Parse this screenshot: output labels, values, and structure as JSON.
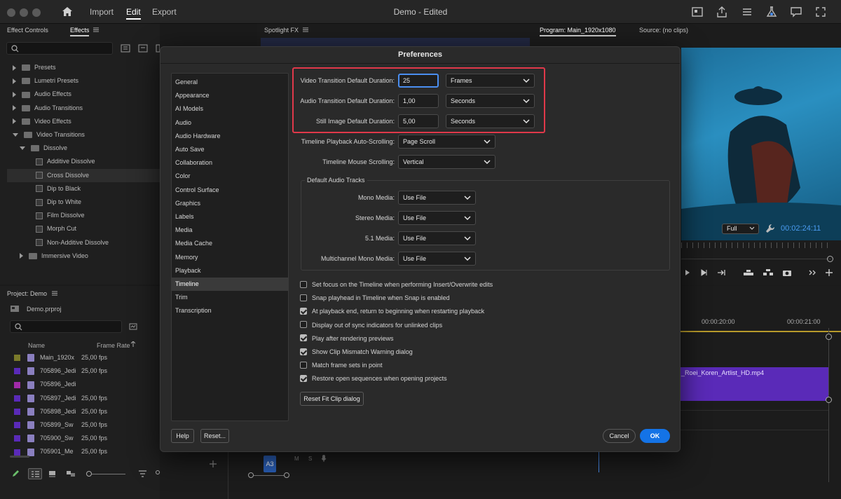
{
  "app": {
    "menu": {
      "import": "Import",
      "edit": "Edit",
      "export": "Export"
    },
    "document_title": "Demo - Edited"
  },
  "effects_panel": {
    "tab_effect_controls": "Effect Controls",
    "tab_effects": "Effects",
    "tree": [
      {
        "label": "Presets",
        "kind": "folder",
        "depth": 0,
        "expanded": false
      },
      {
        "label": "Lumetri Presets",
        "kind": "folder",
        "depth": 0,
        "expanded": false
      },
      {
        "label": "Audio Effects",
        "kind": "folder",
        "depth": 0,
        "expanded": false
      },
      {
        "label": "Audio Transitions",
        "kind": "folder",
        "depth": 0,
        "expanded": false
      },
      {
        "label": "Video Effects",
        "kind": "folder",
        "depth": 0,
        "expanded": false
      },
      {
        "label": "Video Transitions",
        "kind": "folder",
        "depth": 0,
        "expanded": true
      },
      {
        "label": "Dissolve",
        "kind": "folder",
        "depth": 1,
        "expanded": true
      },
      {
        "label": "Additive Dissolve",
        "kind": "effect",
        "depth": 2
      },
      {
        "label": "Cross Dissolve",
        "kind": "effect",
        "depth": 2,
        "selected": true
      },
      {
        "label": "Dip to Black",
        "kind": "effect",
        "depth": 2
      },
      {
        "label": "Dip to White",
        "kind": "effect",
        "depth": 2
      },
      {
        "label": "Film Dissolve",
        "kind": "effect",
        "depth": 2
      },
      {
        "label": "Morph Cut",
        "kind": "effect",
        "depth": 2
      },
      {
        "label": "Non-Additive Dissolve",
        "kind": "effect",
        "depth": 2
      },
      {
        "label": "Immersive Video",
        "kind": "folder",
        "depth": 1,
        "expanded": false
      }
    ]
  },
  "spotlight_panel": {
    "tab": "Spotlight FX"
  },
  "program_panel": {
    "tab_program": "Program: Main_1920x1080",
    "tab_source": "Source: (no clips)",
    "zoom": "Full",
    "timecode": "00:02:24:11"
  },
  "project_panel": {
    "title": "Project: Demo",
    "file": "Demo.prproj",
    "columns": {
      "name": "Name",
      "frame_rate": "Frame Rate"
    },
    "rows": [
      {
        "name": "Main_1920x",
        "fps": "25,00 fps",
        "color": "#7a7a2a"
      },
      {
        "name": "705896_Jedi",
        "fps": "25,00 fps",
        "color": "#5a2ab8"
      },
      {
        "name": "705896_Jedi",
        "fps": "",
        "color": "#a02aa8"
      },
      {
        "name": "705897_Jedi",
        "fps": "25,00 fps",
        "color": "#5a2ab8"
      },
      {
        "name": "705898_Jedi",
        "fps": "25,00 fps",
        "color": "#5a2ab8"
      },
      {
        "name": "705899_Sw",
        "fps": "25,00 fps",
        "color": "#5a2ab8"
      },
      {
        "name": "705900_Sw",
        "fps": "25,00 fps",
        "color": "#5a2ab8"
      },
      {
        "name": "705901_Me",
        "fps": "25,00 fps",
        "color": "#5a2ab8"
      }
    ]
  },
  "timeline": {
    "ruler": [
      "00:00:20:00",
      "00:00:21:00"
    ],
    "clip_name": "_Roei_Koren_Artlist_HD.mp4",
    "track_label": "A3",
    "track_m": "M",
    "track_s": "S"
  },
  "preferences": {
    "title": "Preferences",
    "categories": [
      "General",
      "Appearance",
      "AI Models",
      "Audio",
      "Audio Hardware",
      "Auto Save",
      "Collaboration",
      "Color",
      "Control Surface",
      "Graphics",
      "Labels",
      "Media",
      "Media Cache",
      "Memory",
      "Playback",
      "Timeline",
      "Trim",
      "Transcription"
    ],
    "selected_category": "Timeline",
    "video_transition": {
      "label": "Video Transition Default Duration:",
      "value": "25",
      "unit": "Frames"
    },
    "audio_transition": {
      "label": "Audio Transition Default Duration:",
      "value": "1,00",
      "unit": "Seconds"
    },
    "still_image": {
      "label": "Still Image Default Duration:",
      "value": "5,00",
      "unit": "Seconds"
    },
    "playback_scrolling": {
      "label": "Timeline Playback Auto-Scrolling:",
      "value": "Page Scroll"
    },
    "mouse_scrolling": {
      "label": "Timeline Mouse Scrolling:",
      "value": "Vertical"
    },
    "audio_tracks": {
      "group_title": "Default Audio Tracks",
      "mono": {
        "label": "Mono Media:",
        "value": "Use File"
      },
      "stereo": {
        "label": "Stereo Media:",
        "value": "Use File"
      },
      "surround": {
        "label": "5.1 Media:",
        "value": "Use File"
      },
      "multichannel": {
        "label": "Multichannel Mono Media:",
        "value": "Use File"
      }
    },
    "checkboxes": [
      {
        "label": "Set focus on the Timeline when performing Insert/Overwrite edits",
        "checked": false
      },
      {
        "label": "Snap playhead in Timeline when Snap is enabled",
        "checked": false
      },
      {
        "label": "At playback end, return to beginning when restarting playback",
        "checked": true
      },
      {
        "label": "Display out of sync indicators for unlinked clips",
        "checked": false
      },
      {
        "label": "Play after rendering previews",
        "checked": true
      },
      {
        "label": "Show Clip Mismatch Warning dialog",
        "checked": true
      },
      {
        "label": "Match frame sets in point",
        "checked": false
      },
      {
        "label": "Restore open sequences when opening projects",
        "checked": true
      }
    ],
    "reset_fit_clip": "Reset Fit Clip dialog",
    "buttons": {
      "help": "Help",
      "reset": "Reset...",
      "cancel": "Cancel",
      "ok": "OK"
    },
    "colors": {
      "highlight": "#e0384a",
      "accent": "#1473e6",
      "focus": "#4a8ef0"
    }
  }
}
